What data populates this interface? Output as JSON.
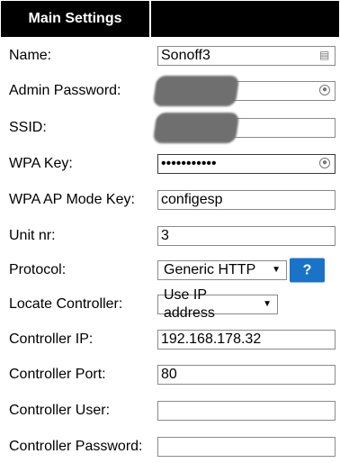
{
  "header": {
    "title": "Main Settings"
  },
  "fields": [
    {
      "label": "Name:",
      "value": "Sonoff3",
      "icon": "contacts-autofill-icon"
    },
    {
      "label": "Admin Password:",
      "value": "",
      "icon": "password-reveal-icon",
      "redacted": true
    },
    {
      "label": "SSID:",
      "value": "",
      "redacted": true
    },
    {
      "label": "WPA Key:",
      "value": "•••••••••••",
      "icon": "password-reveal-icon"
    },
    {
      "label": "WPA AP Mode Key:",
      "value": "configesp"
    },
    {
      "label": "Unit nr:",
      "value": "3"
    },
    {
      "label": "Protocol:",
      "select_value": "Generic HTTP",
      "help_label": "?"
    },
    {
      "label": "Locate Controller:",
      "select_value": "Use IP address"
    },
    {
      "label": "Controller IP:",
      "value": "192.168.178.32"
    },
    {
      "label": "Controller Port:",
      "value": "80"
    },
    {
      "label": "Controller User:",
      "value": ""
    },
    {
      "label": "Controller Password:",
      "value": ""
    }
  ],
  "colors": {
    "header_bg": "#000000",
    "help_button": "#1a73c7"
  }
}
